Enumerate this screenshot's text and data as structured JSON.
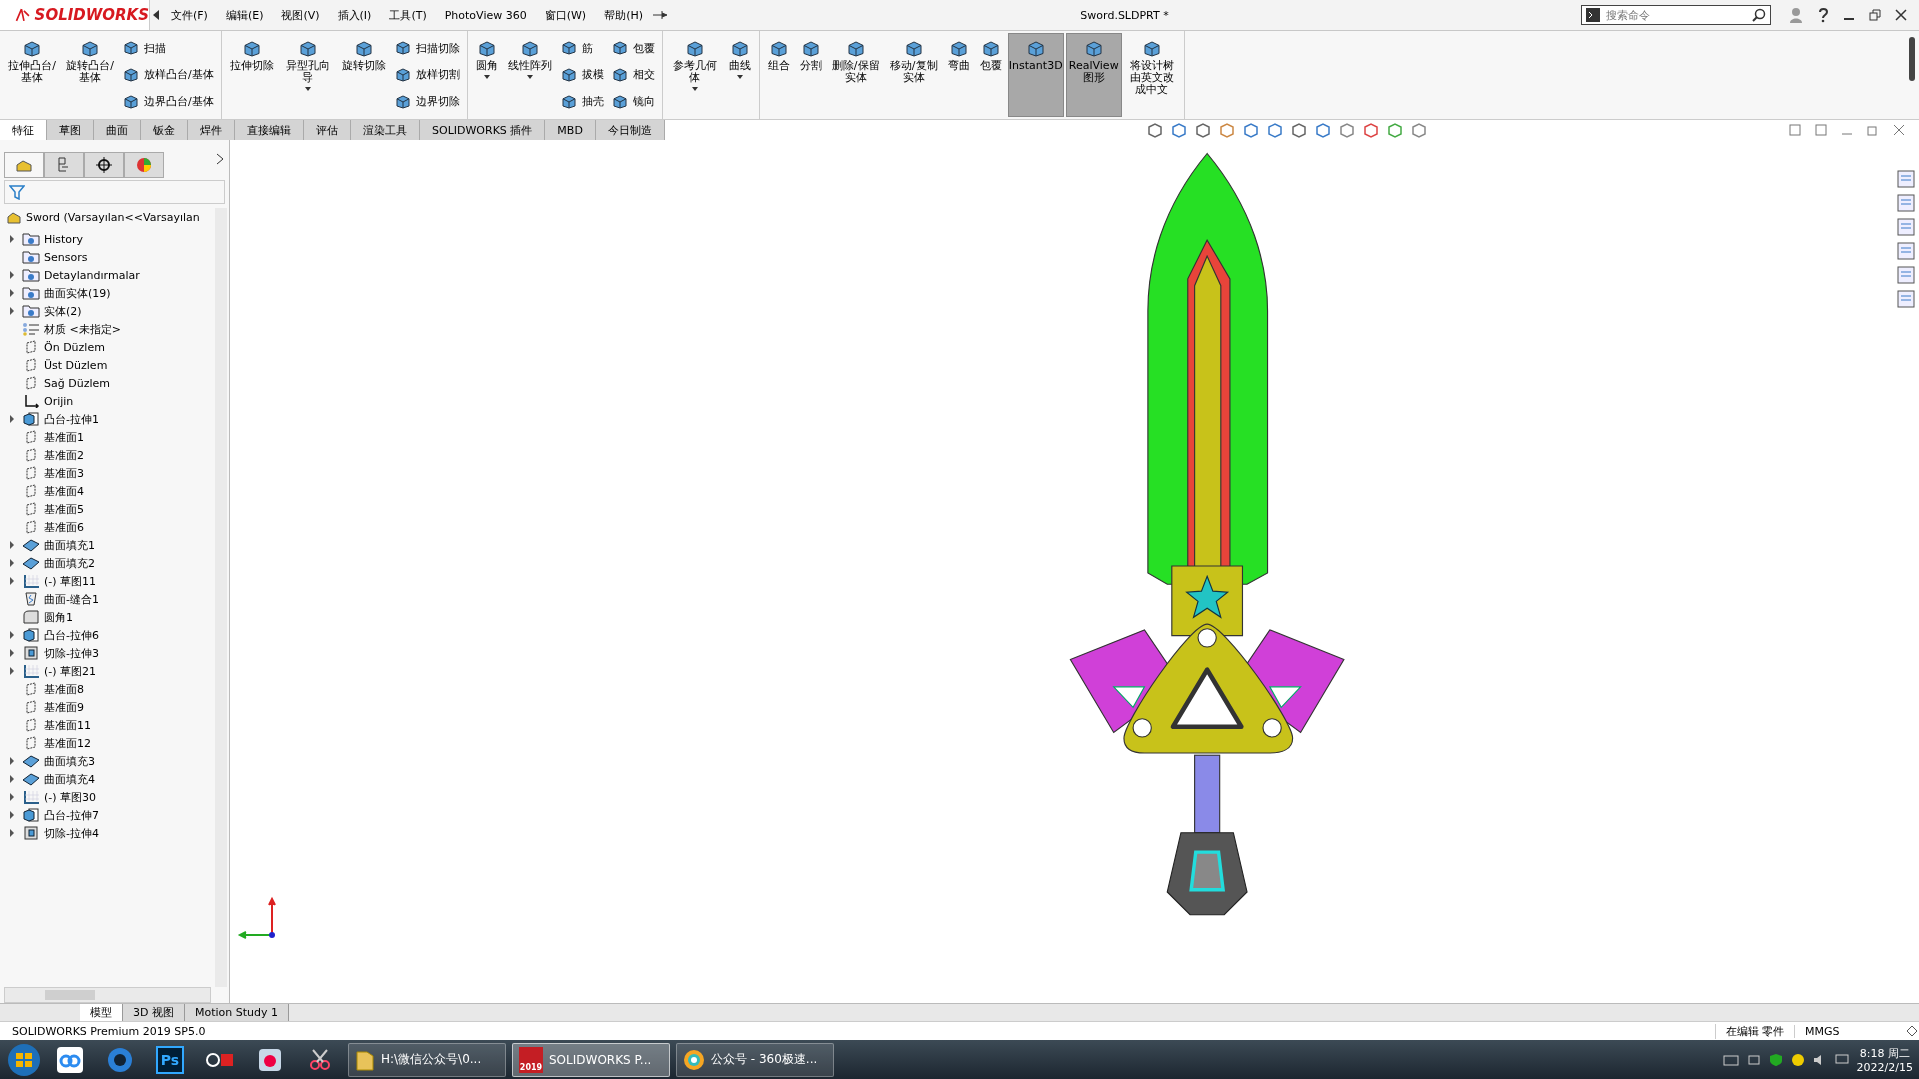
{
  "title_bar": {
    "logo": "SOLIDWORKS",
    "menus": [
      "文件(F)",
      "编辑(E)",
      "视图(V)",
      "插入(I)",
      "工具(T)",
      "PhotoView 360",
      "窗口(W)",
      "帮助(H)"
    ],
    "document_title": "Sword.SLDPRT *",
    "search_placeholder": "搜索命令"
  },
  "ribbon": [
    {
      "columns": [
        {
          "kind": "large",
          "label": "拉伸凸台/基体",
          "dropdown": false,
          "on": false
        },
        {
          "kind": "large",
          "label": "旋转凸台/基体",
          "dropdown": false,
          "on": false
        },
        {
          "kind": "stack",
          "items": [
            "扫描",
            "放样凸台/基体",
            "边界凸台/基体"
          ]
        }
      ]
    },
    {
      "columns": [
        {
          "kind": "large",
          "label": "拉伸切除",
          "dropdown": false,
          "on": false
        },
        {
          "kind": "large",
          "label": "异型孔向导",
          "dropdown": true,
          "on": false
        },
        {
          "kind": "large",
          "label": "旋转切除",
          "dropdown": false,
          "on": false
        },
        {
          "kind": "stack",
          "items": [
            "扫描切除",
            "放样切割",
            "边界切除"
          ]
        }
      ]
    },
    {
      "columns": [
        {
          "kind": "large",
          "label": "圆角",
          "dropdown": true,
          "on": false
        },
        {
          "kind": "large",
          "label": "线性阵列",
          "dropdown": true,
          "on": false
        },
        {
          "kind": "stack",
          "items": [
            "筋",
            "拔模",
            "抽壳"
          ]
        },
        {
          "kind": "stack",
          "items": [
            "包覆",
            "相交",
            "镜向"
          ]
        }
      ]
    },
    {
      "columns": [
        {
          "kind": "large",
          "label": "参考几何体",
          "dropdown": true,
          "on": false
        },
        {
          "kind": "large",
          "label": "曲线",
          "dropdown": true,
          "on": false
        }
      ]
    },
    {
      "columns": [
        {
          "kind": "large",
          "label": "组合",
          "dropdown": false,
          "on": false
        },
        {
          "kind": "large",
          "label": "分割",
          "dropdown": false,
          "on": false
        },
        {
          "kind": "large",
          "label": "删除/保留实体",
          "dropdown": false,
          "on": false
        },
        {
          "kind": "large",
          "label": "移动/复制实体",
          "dropdown": false,
          "on": false
        },
        {
          "kind": "large",
          "label": "弯曲",
          "dropdown": false,
          "on": false
        },
        {
          "kind": "large",
          "label": "包覆",
          "dropdown": false,
          "on": false
        },
        {
          "kind": "large",
          "label": "Instant3D",
          "dropdown": false,
          "on": true
        },
        {
          "kind": "large",
          "label": "RealView 图形",
          "dropdown": false,
          "on": true
        },
        {
          "kind": "large",
          "label": "将设计树由英文改成中文",
          "dropdown": false,
          "on": false
        }
      ]
    }
  ],
  "tabs": [
    {
      "label": "特征",
      "selected": true
    },
    {
      "label": "草图",
      "selected": false
    },
    {
      "label": "曲面",
      "selected": false
    },
    {
      "label": "钣金",
      "selected": false
    },
    {
      "label": "焊件",
      "selected": false
    },
    {
      "label": "直接编辑",
      "selected": false
    },
    {
      "label": "评估",
      "selected": false
    },
    {
      "label": "渲染工具",
      "selected": false
    },
    {
      "label": "SOLIDWORKS 插件",
      "selected": false
    },
    {
      "label": "MBD",
      "selected": false
    },
    {
      "label": "今日制造",
      "selected": false
    }
  ],
  "panel_tabs": [
    {
      "selected": true
    },
    {
      "selected": false
    },
    {
      "selected": false
    },
    {
      "selected": false
    }
  ],
  "feature_tree": {
    "root": "Sword  (Varsayılan<<Varsayılan",
    "items": [
      {
        "label": "History",
        "kind": "folder",
        "expandable": true
      },
      {
        "label": "Sensors",
        "kind": "folder",
        "expandable": false
      },
      {
        "label": "Detaylandırmalar",
        "kind": "folder",
        "expandable": true
      },
      {
        "label": "曲面实体(19)",
        "kind": "folder",
        "expandable": true
      },
      {
        "label": "实体(2)",
        "kind": "folder",
        "expandable": true
      },
      {
        "label": "材质 <未指定>",
        "kind": "material",
        "expandable": false
      },
      {
        "label": "Ön Düzlem",
        "kind": "plane",
        "expandable": false
      },
      {
        "label": "Üst Düzlem",
        "kind": "plane",
        "expandable": false
      },
      {
        "label": "Sağ Düzlem",
        "kind": "plane",
        "expandable": false
      },
      {
        "label": "Orijin",
        "kind": "origin",
        "expandable": false
      },
      {
        "label": "凸台-拉伸1",
        "kind": "boss",
        "expandable": true
      },
      {
        "label": "基准面1",
        "kind": "plane",
        "expandable": false
      },
      {
        "label": "基准面2",
        "kind": "plane",
        "expandable": false
      },
      {
        "label": "基准面3",
        "kind": "plane",
        "expandable": false
      },
      {
        "label": "基准面4",
        "kind": "plane",
        "expandable": false
      },
      {
        "label": "基准面5",
        "kind": "plane",
        "expandable": false
      },
      {
        "label": "基准面6",
        "kind": "plane",
        "expandable": false
      },
      {
        "label": "曲面填充1",
        "kind": "surface",
        "expandable": true
      },
      {
        "label": "曲面填充2",
        "kind": "surface",
        "expandable": true
      },
      {
        "label": "(-) 草图11",
        "kind": "sketch",
        "expandable": true
      },
      {
        "label": "曲面-缝合1",
        "kind": "knit",
        "expandable": false
      },
      {
        "label": "圆角1",
        "kind": "fillet",
        "expandable": false
      },
      {
        "label": "凸台-拉伸6",
        "kind": "boss",
        "expandable": true
      },
      {
        "label": "切除-拉伸3",
        "kind": "cut",
        "expandable": true
      },
      {
        "label": "(-) 草图21",
        "kind": "sketch",
        "expandable": true
      },
      {
        "label": "基准面8",
        "kind": "plane",
        "expandable": false
      },
      {
        "label": "基准面9",
        "kind": "plane",
        "expandable": false
      },
      {
        "label": "基准面11",
        "kind": "plane",
        "expandable": false
      },
      {
        "label": "基准面12",
        "kind": "plane",
        "expandable": false
      },
      {
        "label": "曲面填充3",
        "kind": "surface",
        "expandable": true
      },
      {
        "label": "曲面填充4",
        "kind": "surface",
        "expandable": true
      },
      {
        "label": "(-) 草图30",
        "kind": "sketch",
        "expandable": true
      },
      {
        "label": "凸台-拉伸7",
        "kind": "boss",
        "expandable": true
      },
      {
        "label": "切除-拉伸4",
        "kind": "cut",
        "expandable": true
      }
    ]
  },
  "bottom_tabs": [
    {
      "label": "模型",
      "selected": true
    },
    {
      "label": "3D 视图",
      "selected": false
    },
    {
      "label": "Motion Study 1",
      "selected": false
    }
  ],
  "status_bar": {
    "product": "SOLIDWORKS Premium 2019 SP5.0",
    "mode": "在编辑 零件",
    "units": "MMGS"
  },
  "taskbar": {
    "pinned": [
      {
        "kind": "cloud"
      },
      {
        "kind": "ring"
      },
      {
        "kind": "ps",
        "label": "Ps"
      },
      {
        "kind": "obs"
      },
      {
        "kind": "disk"
      },
      {
        "kind": "tool"
      }
    ],
    "windows": [
      {
        "kind": "folder",
        "label": "H:\\微信公众号\\0...",
        "selected": false
      },
      {
        "kind": "sw",
        "label": "SOLIDWORKS P...",
        "badge": "2019",
        "selected": true
      },
      {
        "kind": "browser",
        "label": "公众号 - 360极速...",
        "selected": false
      }
    ],
    "time": "8:18 周二",
    "date": "2022/2/15"
  }
}
